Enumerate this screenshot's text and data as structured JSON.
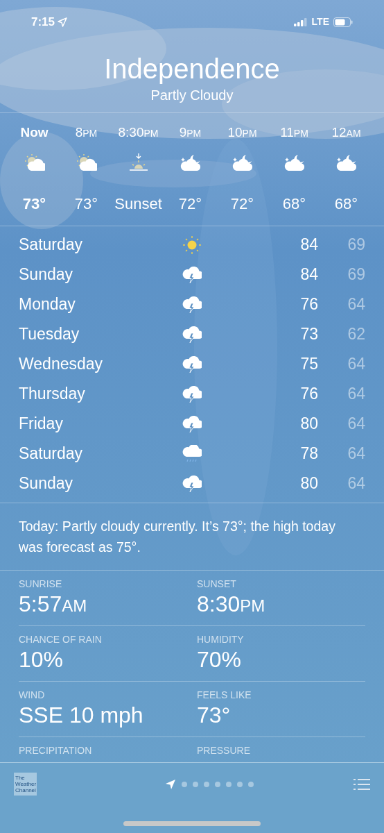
{
  "status_bar": {
    "time": "7:15",
    "network": "LTE"
  },
  "header": {
    "city": "Independence",
    "condition": "Partly Cloudy"
  },
  "hourly": [
    {
      "time": "Now",
      "kind": "partly-cloudy-day",
      "temp": "73°",
      "current": true
    },
    {
      "time": "8",
      "suffix": "PM",
      "kind": "partly-cloudy-day",
      "temp": "73°",
      "current": false
    },
    {
      "time": "8:30",
      "suffix": "PM",
      "kind": "sunset",
      "temp": "Sunset",
      "current": false
    },
    {
      "time": "9",
      "suffix": "PM",
      "kind": "partly-cloudy-night",
      "temp": "72°",
      "current": false
    },
    {
      "time": "10",
      "suffix": "PM",
      "kind": "partly-cloudy-night",
      "temp": "72°",
      "current": false
    },
    {
      "time": "11",
      "suffix": "PM",
      "kind": "partly-cloudy-night",
      "temp": "68°",
      "current": false
    },
    {
      "time": "12",
      "suffix": "AM",
      "kind": "partly-cloudy-night",
      "temp": "68°",
      "current": false
    }
  ],
  "daily": [
    {
      "day": "Saturday",
      "kind": "sun",
      "high": "84",
      "low": "69"
    },
    {
      "day": "Sunday",
      "kind": "thunderstorm",
      "high": "84",
      "low": "69"
    },
    {
      "day": "Monday",
      "kind": "thunderstorm",
      "high": "76",
      "low": "64"
    },
    {
      "day": "Tuesday",
      "kind": "thunderstorm",
      "high": "73",
      "low": "62"
    },
    {
      "day": "Wednesday",
      "kind": "thunderstorm",
      "high": "75",
      "low": "64"
    },
    {
      "day": "Thursday",
      "kind": "thunderstorm",
      "high": "76",
      "low": "64"
    },
    {
      "day": "Friday",
      "kind": "thunderstorm",
      "high": "80",
      "low": "64"
    },
    {
      "day": "Saturday",
      "kind": "rain",
      "high": "78",
      "low": "64"
    },
    {
      "day": "Sunday",
      "kind": "thunderstorm",
      "high": "80",
      "low": "64"
    }
  ],
  "summary": "Today: Partly cloudy currently. It’s 73°; the high today was forecast as 75°.",
  "details": [
    {
      "label": "SUNRISE",
      "value": "5:57",
      "suffix": "AM"
    },
    {
      "label": "SUNSET",
      "value": "8:30",
      "suffix": "PM"
    },
    {
      "label": "CHANCE OF RAIN",
      "value": "10%"
    },
    {
      "label": "HUMIDITY",
      "value": "70%"
    },
    {
      "label": "WIND",
      "value": "SSE 10 mph"
    },
    {
      "label": "FEELS LIKE",
      "value": "73°"
    },
    {
      "label": "PRECIPITATION"
    },
    {
      "label": "PRESSURE"
    }
  ],
  "bottom_bar": {
    "logo": [
      "The",
      "Weather",
      "Channel"
    ],
    "pages": [
      {
        "kind": "location",
        "selected": true
      },
      {
        "kind": "dot",
        "selected": false
      },
      {
        "kind": "dot",
        "selected": false
      },
      {
        "kind": "dot",
        "selected": false
      },
      {
        "kind": "dot",
        "selected": false
      },
      {
        "kind": "dot",
        "selected": false
      },
      {
        "kind": "dot",
        "selected": false
      },
      {
        "kind": "dot",
        "selected": false
      }
    ]
  }
}
